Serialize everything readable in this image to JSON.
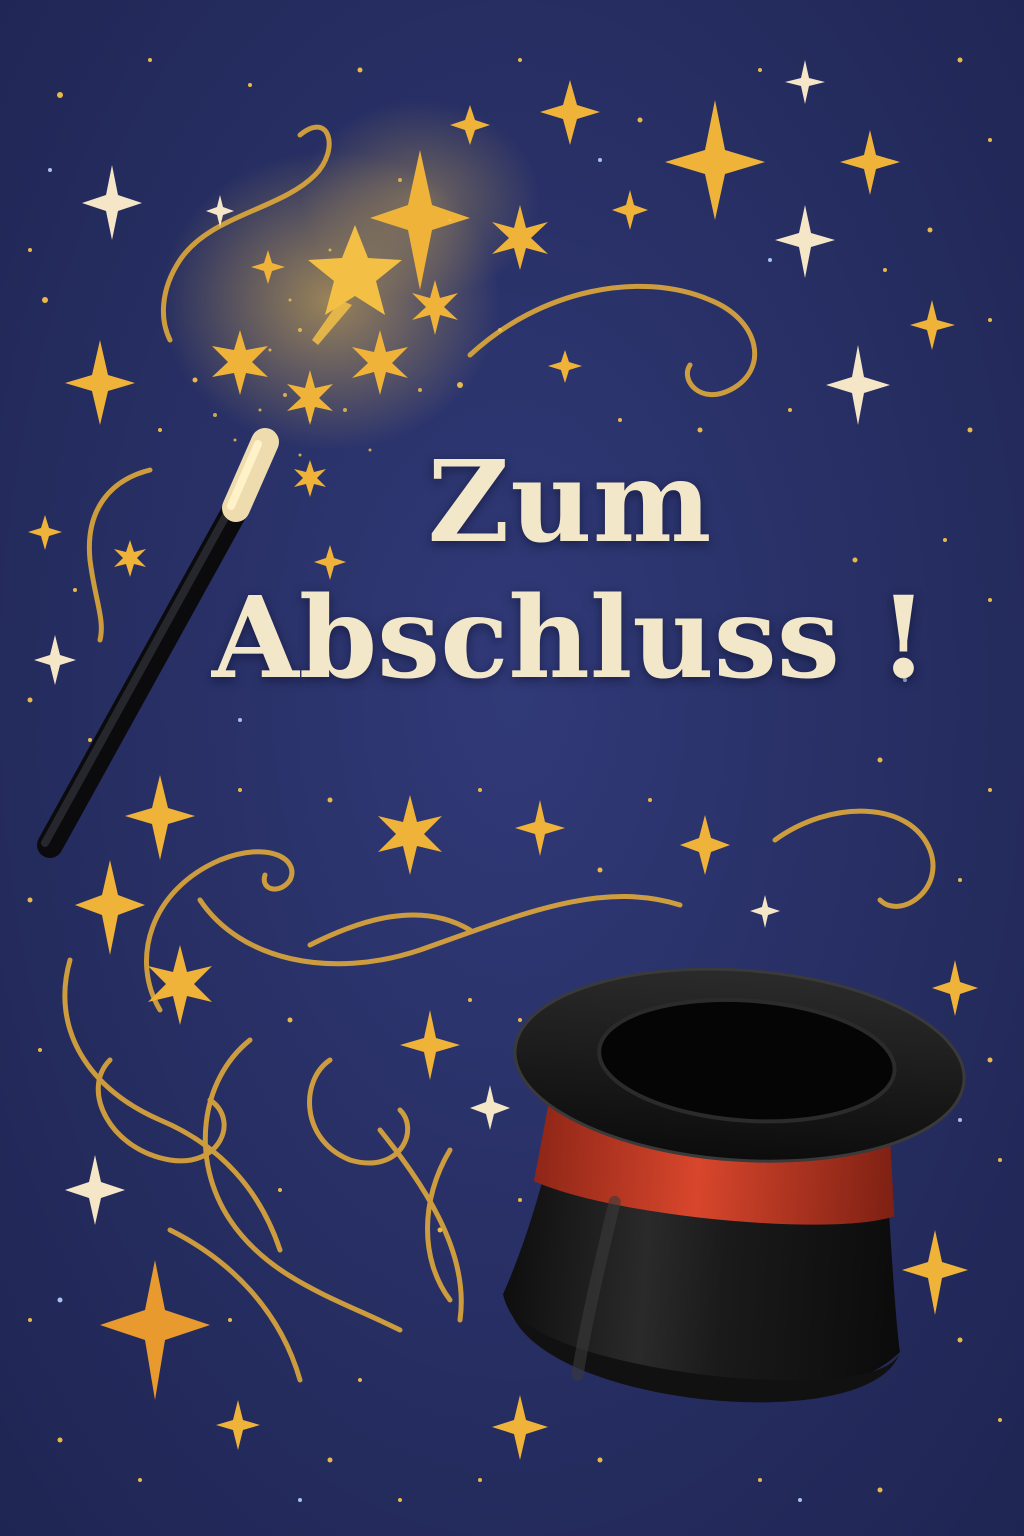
{
  "headline": {
    "line1": "Zum",
    "line2": "Abschluss !"
  },
  "colors": {
    "background": "#283066",
    "gold": "#f2b433",
    "cream": "#f3e7c9",
    "hat": "#161616",
    "hat_band": "#c23a24"
  },
  "icons": [
    "magic-wand-icon",
    "top-hat-icon",
    "sparkle-star-icon",
    "swirl-ornament"
  ]
}
